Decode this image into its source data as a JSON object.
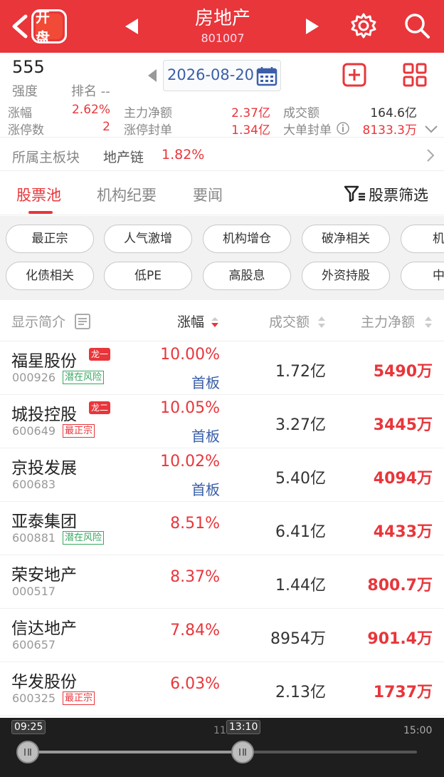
{
  "header": {
    "logo_text": "开盘",
    "title": "房地产",
    "code": "801007"
  },
  "info": {
    "strength_value": "555",
    "strength_label": "强度",
    "rank_label": "排名 --",
    "date": "2026-08-20",
    "stats": [
      {
        "label": "涨幅",
        "value": "2.62%"
      },
      {
        "label": "主力净额",
        "value": "2.37亿"
      },
      {
        "label": "成交额",
        "value": "164.6亿"
      },
      {
        "label": "涨停数",
        "value": "2"
      },
      {
        "label": "涨停封单",
        "value": "1.34亿"
      },
      {
        "label": "大单封单",
        "value": "8133.3万"
      }
    ]
  },
  "sector": {
    "label": "所属主板块",
    "name": "地产链",
    "change": "1.82%"
  },
  "tabs": [
    {
      "label": "股票池"
    },
    {
      "label": "机构纪要"
    },
    {
      "label": "要闻"
    }
  ],
  "filter_label": "股票筛选",
  "tags": [
    "最正宗",
    "人气激增",
    "机构增仓",
    "破净相关",
    "机构",
    "化债相关",
    "低PE",
    "高股息",
    "外资持股",
    "中报"
  ],
  "table": {
    "headers": {
      "name": "显示简介",
      "change": "涨幅",
      "volume": "成交额",
      "net": "主力净额"
    },
    "rows": [
      {
        "name": "福星股份",
        "badge": "龙一",
        "code": "000926",
        "tag": "潜在风险",
        "change": "10.00%",
        "board": "首板",
        "volume": "1.72亿",
        "net": "5490万"
      },
      {
        "name": "城投控股",
        "badge": "龙二",
        "code": "600649",
        "tag": "最正宗",
        "change": "10.05%",
        "board": "首板",
        "volume": "3.27亿",
        "net": "3445万"
      },
      {
        "name": "京投发展",
        "badge": "",
        "code": "600683",
        "tag": "",
        "change": "10.02%",
        "board": "首板",
        "volume": "5.40亿",
        "net": "4094万"
      },
      {
        "name": "亚泰集团",
        "badge": "",
        "code": "600881",
        "tag": "潜在风险",
        "change": "8.51%",
        "board": "",
        "volume": "6.41亿",
        "net": "4433万"
      },
      {
        "name": "荣安地产",
        "badge": "",
        "code": "000517",
        "tag": "",
        "change": "8.37%",
        "board": "",
        "volume": "1.44亿",
        "net": "800.7万"
      },
      {
        "name": "信达地产",
        "badge": "",
        "code": "600657",
        "tag": "",
        "change": "7.84%",
        "board": "",
        "volume": "8954万",
        "net": "901.4万"
      },
      {
        "name": "华发股份",
        "badge": "",
        "code": "600325",
        "tag": "最正宗",
        "change": "6.03%",
        "board": "",
        "volume": "2.13亿",
        "net": "1737万"
      }
    ]
  },
  "timeline": {
    "start": "09:25",
    "mid": "11",
    "current": "13:10",
    "end": "15:00"
  }
}
